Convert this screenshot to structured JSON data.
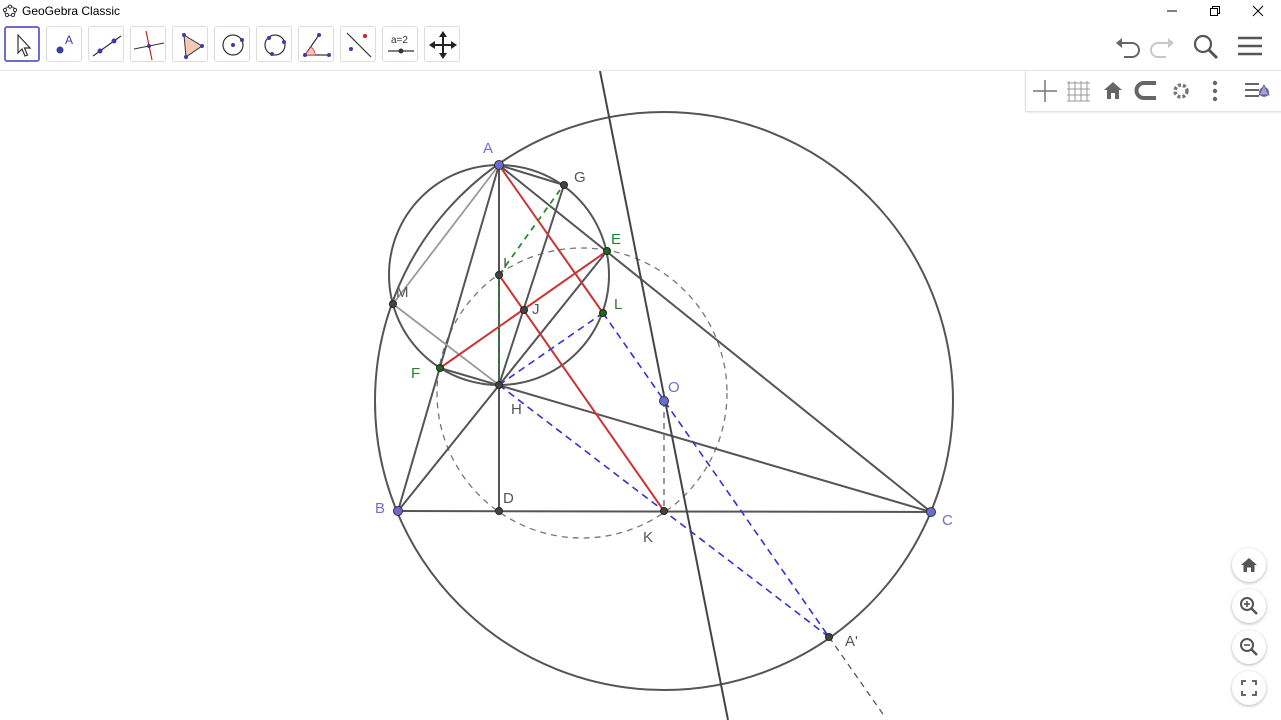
{
  "window": {
    "title": "GeoGebra Classic",
    "controls": [
      "minimize",
      "restore",
      "close"
    ]
  },
  "toolbar": {
    "tools": [
      {
        "icon": "move-arrow-icon",
        "active": true
      },
      {
        "icon": "point-icon",
        "active": false
      },
      {
        "icon": "line-icon",
        "active": false
      },
      {
        "icon": "perpendicular-line-icon",
        "active": false
      },
      {
        "icon": "polygon-icon",
        "active": false
      },
      {
        "icon": "circle-center-point-icon",
        "active": false
      },
      {
        "icon": "circle-three-points-icon",
        "active": false
      },
      {
        "icon": "angle-icon",
        "active": false
      },
      {
        "icon": "reflect-about-line-icon",
        "active": false
      },
      {
        "icon": "slider-icon",
        "label": "a=2",
        "active": false
      },
      {
        "icon": "move-graphics-view-icon",
        "active": false
      }
    ],
    "right": [
      "undo-icon",
      "redo-icon",
      "search-icon",
      "menu-icon"
    ]
  },
  "style_bar": [
    "axes-icon",
    "grid-icon",
    "home-icon",
    "point-capturing-icon",
    "settings-gear-icon",
    "more-vertical-icon",
    "toggle-style-bar-icon"
  ],
  "zoom_controls": [
    "home-icon",
    "zoom-in-icon",
    "zoom-out-icon",
    "fullscreen-icon"
  ],
  "diagram": {
    "colors": {
      "point": "#6b6bd6",
      "green_point": "#1a6b1a",
      "red": "#cc3333",
      "blue_dashed": "#3333cc",
      "green_dashed": "#2d8a2d",
      "gray": "#555555",
      "label_blue": "#6f6fcf",
      "label_green": "#2e7d32",
      "label_gray": "#555555"
    },
    "labels": {
      "A": "A",
      "B": "B",
      "C": "C",
      "D": "D",
      "E": "E",
      "F": "F",
      "G": "G",
      "H": "H",
      "I": "I",
      "J": "J",
      "K": "K",
      "L": "L",
      "M": "M",
      "O": "O",
      "A2": "A'"
    }
  }
}
